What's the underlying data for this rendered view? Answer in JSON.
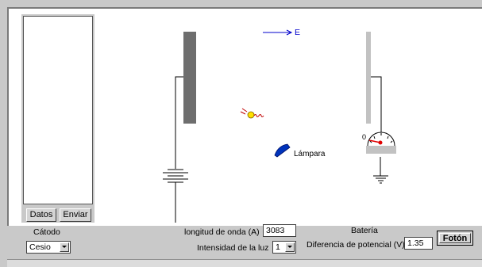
{
  "buttons": {
    "datos": "Datos",
    "enviar": "Enviar",
    "foton": "Fotón"
  },
  "scene": {
    "field_label": "E",
    "lamp_label": "Lámpara",
    "meter_zero": "0"
  },
  "controls": {
    "cathode_label": "Cátodo",
    "cathode_value": "Cesio",
    "wavelength_label": "longitud de onda (A)",
    "wavelength_value": "3083",
    "intensity_label": "Intensidad de la luz",
    "intensity_value": "1",
    "battery_label": "Batería",
    "potential_label": "Diferencia de potencial (V)",
    "potential_value": "1.35"
  },
  "colors": {
    "cathode_plate": "#6e6e6e",
    "anode_plate": "#c2c2c2",
    "field_arrow": "#0000cc",
    "lamp": "#0033bb",
    "photon": "#ffe000",
    "meter_needle": "#e00000"
  }
}
